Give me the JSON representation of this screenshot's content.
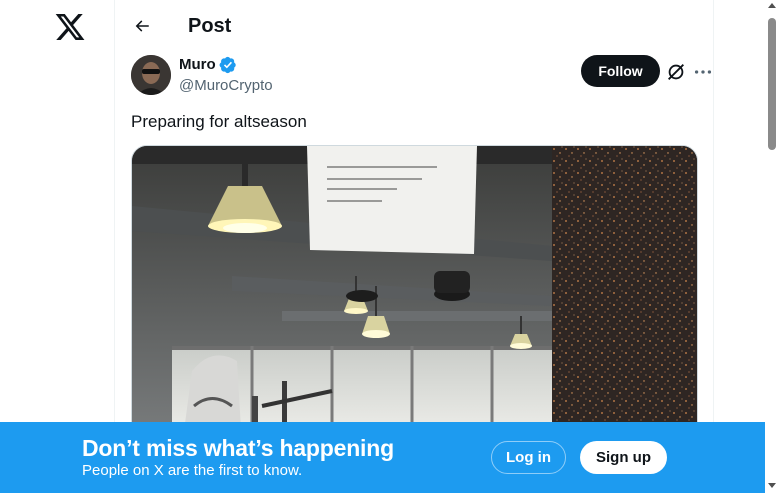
{
  "header": {
    "title": "Post",
    "back_icon": "arrow-left-icon"
  },
  "logo": {
    "icon": "x-logo-icon"
  },
  "post": {
    "author": {
      "display_name": "Muro",
      "handle": "@MuroCrypto",
      "verified": true,
      "verified_color": "#1d9bf0"
    },
    "follow_label": "Follow",
    "grok_icon": "grok-icon",
    "more_icon": "more-horizontal-icon",
    "text": "Preparing for altseason",
    "media": {
      "description_icon": "photo",
      "sign_lines": [
        "Bitte du schaust das, dein Sessel zurücklegen",
        "Vielen Dank für euer Personal",
        "Die Kleine hatte ab ganz",
        "Danke, dein FIX Team"
      ]
    }
  },
  "banner": {
    "title": "Don’t miss what’s happening",
    "subtitle": "People on X are the first to know.",
    "login_label": "Log in",
    "signup_label": "Sign up",
    "background": "#1d9bf0"
  },
  "colors": {
    "text": "#0f1419",
    "secondary": "#536471",
    "accent": "#1d9bf0"
  }
}
